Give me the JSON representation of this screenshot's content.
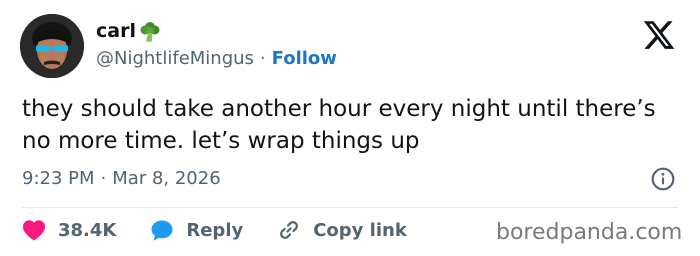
{
  "author": {
    "display_name": "carl",
    "handle": "@NightlifeMingus",
    "follow_label": "Follow",
    "separator": "·"
  },
  "tweet": {
    "text": "they should take another hour every night until there’s no more time. let’s wrap things up",
    "time": "9:23 PM",
    "date": "Mar 8, 2026",
    "separator": "·"
  },
  "actions": {
    "likes": "38.4K",
    "reply_label": "Reply",
    "copy_link_label": "Copy link"
  },
  "watermark": "boredpanda.com",
  "icons": {
    "name_badge": "broccoli-icon",
    "platform": "x-logo-icon",
    "info": "info-icon",
    "like": "heart-icon",
    "reply": "speech-bubble-icon",
    "copy_link": "link-icon"
  },
  "colors": {
    "text": "#0f1419",
    "secondary": "#536471",
    "follow": "#1d77c7",
    "heart": "#f91880",
    "reply": "#1d9bf0",
    "watermark": "#7a7a7a"
  }
}
